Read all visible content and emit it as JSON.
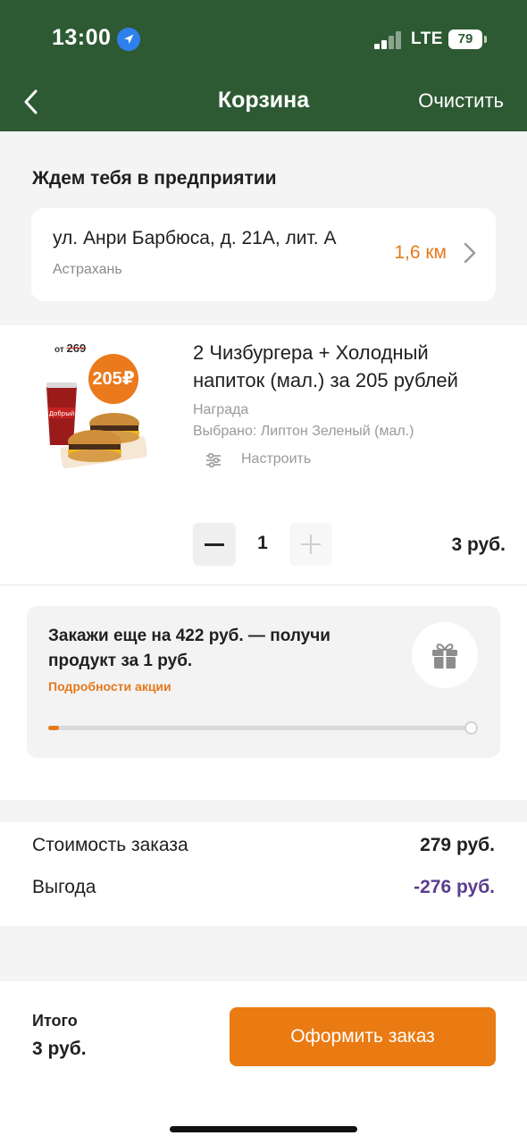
{
  "status_bar": {
    "time": "13:00",
    "network": "LTE",
    "battery": "79"
  },
  "nav": {
    "title": "Корзина",
    "clear_label": "Очистить"
  },
  "pickup": {
    "heading": "Ждем тебя в предприятии",
    "address": "ул. Анри Барбюса, д. 21А, лит. А",
    "city": "Астрахань",
    "distance": "1,6 км"
  },
  "product": {
    "image_old_price_prefix": "от",
    "image_old_price": "269",
    "image_price_badge": "205₽",
    "name": "2 Чизбургера + Холодный напиток (мал.) за 205 рублей",
    "tag": "Награда",
    "choice": "Выбрано: Липтон Зеленый (мал.)",
    "customize_label": "Настроить",
    "quantity": "1",
    "price": "3 руб."
  },
  "promo": {
    "text": "Закажи еще на 422 руб. — получи продукт за 1 руб.",
    "link": "Подробности акции",
    "progress_fraction": 0.025
  },
  "summary": {
    "rows": [
      {
        "label": "Стоимость заказа",
        "value": "279 руб."
      },
      {
        "label": "Выгода",
        "value": "-276 руб."
      }
    ]
  },
  "bottom": {
    "total_label": "Итого",
    "total_value": "3 руб.",
    "checkout_label": "Оформить заказ"
  },
  "colors": {
    "header": "#2d5a33",
    "accent": "#e57a1c",
    "discount": "#5b3d8f"
  }
}
